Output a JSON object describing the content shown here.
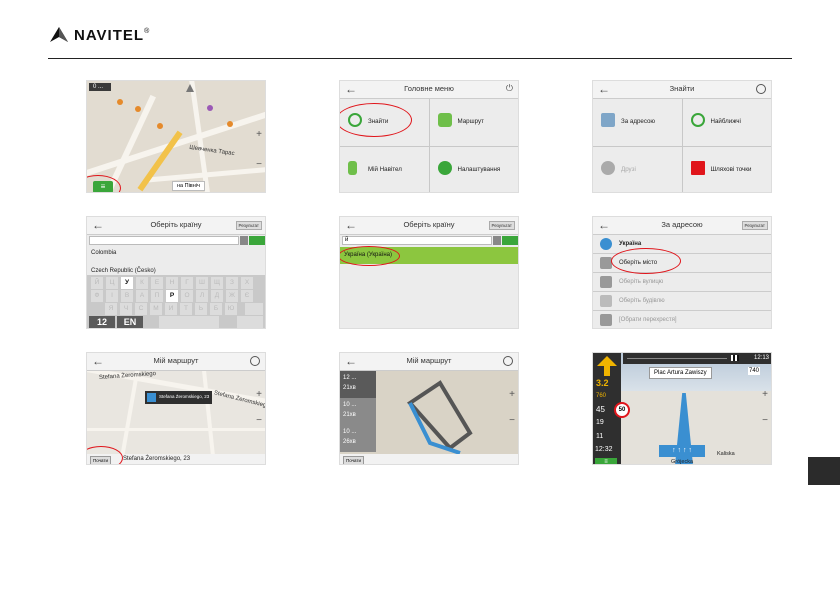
{
  "brand": {
    "name": "NAVITEL",
    "mark": "®"
  },
  "shot1": {
    "scale": "0 ...",
    "street": "Шевченка Тарас",
    "direction": "на Північ",
    "menu_icon": "menu-icon"
  },
  "shot2": {
    "title": "Головне меню",
    "items": [
      "Знайти",
      "Маршрут",
      "Мій Навітел",
      "Налаштування"
    ]
  },
  "shot3": {
    "title": "Знайти",
    "items": [
      "За адресою",
      "Найближчі",
      "Друзі",
      "Шляхові точки"
    ]
  },
  "shot4": {
    "title": "Оберіть країну",
    "right_btn": "Результат",
    "rows": [
      "Colombia",
      "Czech Republic (Česko)"
    ],
    "keys_row1": [
      "Й",
      "Ц",
      "У",
      "К",
      "Е",
      "Н",
      "Г",
      "Ш",
      "Щ",
      "З",
      "Х"
    ],
    "keys_row2": [
      "Ф",
      "І",
      "В",
      "А",
      "П",
      "Р",
      "О",
      "Л",
      "Д",
      "Ж",
      "Є"
    ],
    "keys_row3": [
      "Я",
      "Ч",
      "С",
      "М",
      "И",
      "Т",
      "Ь",
      "Б",
      "Ю"
    ],
    "num_key": "12",
    "lang_key": "EN"
  },
  "shot5": {
    "title": "Оберіть країну",
    "right_btn": "Результат",
    "input_value": "й",
    "result": "Україна (Україна)"
  },
  "shot6": {
    "title": "За адресою",
    "right_btn": "Результат",
    "rows": [
      "Україна",
      "Оберіть місто",
      "Оберіть вулицю",
      "Оберіть будівлю",
      "[Обрати перехрестя]"
    ]
  },
  "shot7": {
    "title": "Мій маршрут",
    "street1": "Stefana Żeromskiego",
    "street2": "Stefana Żeromskiego",
    "popup": "Stefana Żeromskiego, 23",
    "bottom_btn": "Почати",
    "bottom_text": "Stefana Żeromskiego, 23"
  },
  "shot8": {
    "title": "Мій маршрут",
    "routes": [
      {
        "dist": "12 ...",
        "time": "21хв"
      },
      {
        "dist": "10 ...",
        "time": "21хв"
      },
      {
        "dist": "10 ...",
        "time": "26хв"
      }
    ],
    "bottom_btn": "Почати"
  },
  "shot9": {
    "top_street": "Plac Artura Zawiszy",
    "time": "12:13",
    "dist_main": "3.2",
    "dist_unit": "км",
    "speed_limit": "50",
    "speed": "45",
    "info1": "760",
    "info2": "19",
    "info3": "11",
    "clock": "12:32",
    "eta": "740",
    "bottom_street": "Grójecka",
    "side_street": "Kaliska"
  }
}
